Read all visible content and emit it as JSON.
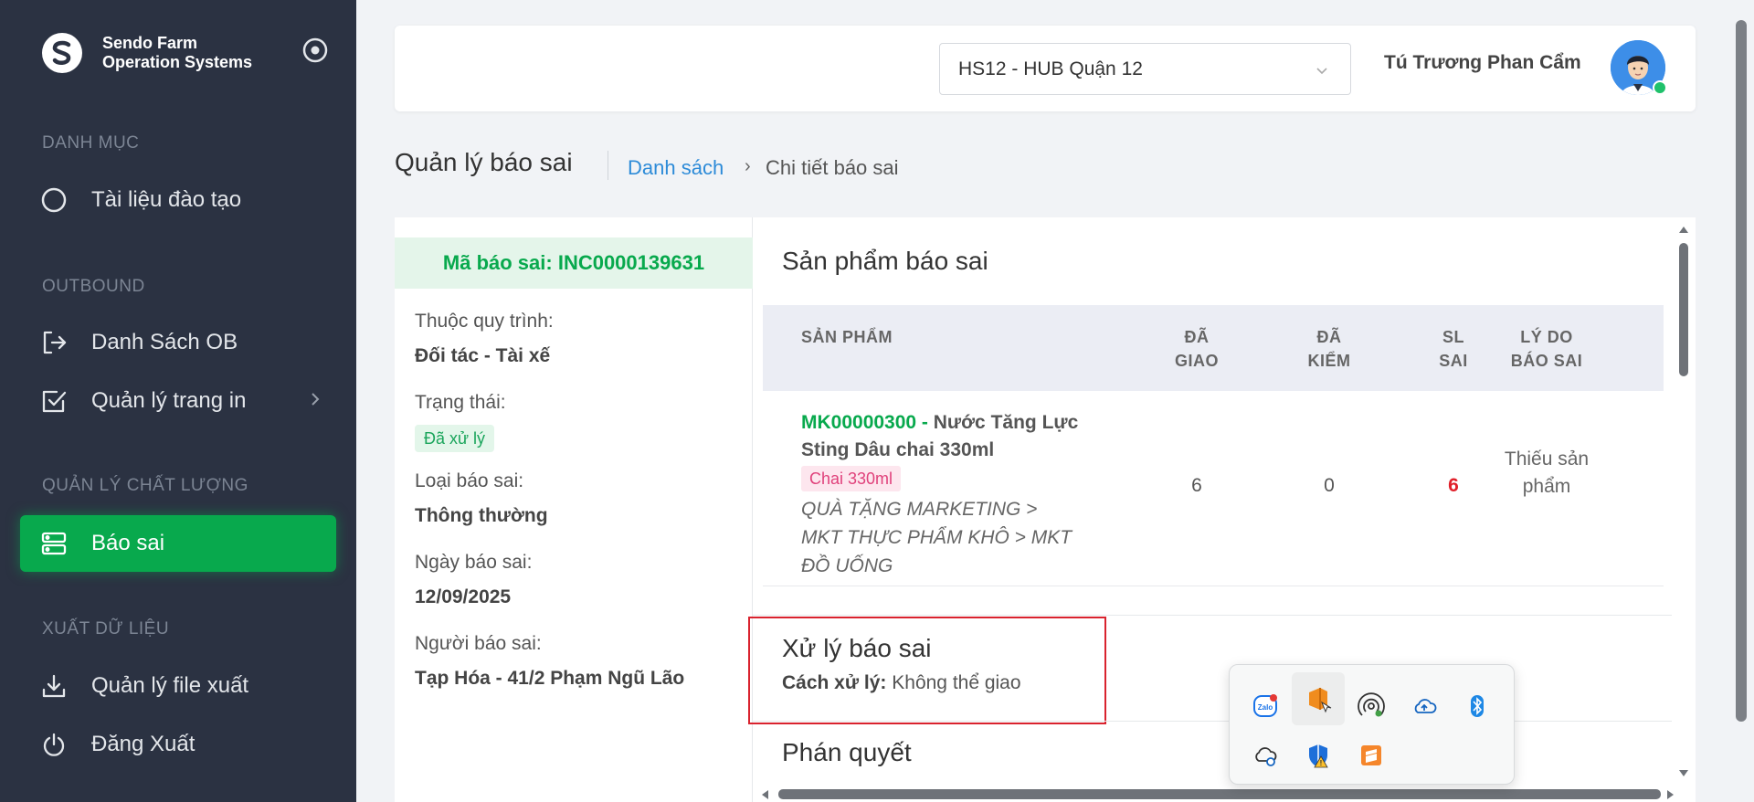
{
  "brand": {
    "line1": "Sendo Farm",
    "line2": "Operation Systems"
  },
  "sidebar": {
    "sections": [
      {
        "label": "DANH MỤC"
      },
      {
        "label": "OUTBOUND"
      },
      {
        "label": "QUẢN LÝ CHẤT LƯỢNG"
      },
      {
        "label": "XUẤT DỮ LIỆU"
      }
    ],
    "items": [
      {
        "label": "Tài liệu đào tạo"
      },
      {
        "label": "Danh Sách OB"
      },
      {
        "label": "Quản lý trang in"
      },
      {
        "label": "Báo sai"
      },
      {
        "label": "Quản lý file xuất"
      },
      {
        "label": "Đăng Xuất"
      }
    ]
  },
  "header": {
    "hub": "HS12 - HUB Quận 12",
    "user": "Tú Trương Phan Cẩm"
  },
  "page": {
    "title": "Quản lý báo sai",
    "crumb_link": "Danh sách",
    "crumb_sep": "›",
    "crumb_current": "Chi tiết báo sai"
  },
  "detail": {
    "code": "Mã báo sai: INC0000139631",
    "process_label": "Thuộc quy trình:",
    "process_value": "Đối tác - Tài xế",
    "status_label": "Trạng thái:",
    "status_value": "Đã xử lý",
    "type_label": "Loại báo sai:",
    "type_value": "Thông thường",
    "date_label": "Ngày báo sai:",
    "date_value": "12/09/2025",
    "reporter_label": "Người báo sai:",
    "reporter_value": "Tạp Hóa - 41/2 Phạm Ngũ Lão"
  },
  "products": {
    "title": "Sản phẩm báo sai",
    "headers": {
      "product": "SẢN PHẨM",
      "delivered_1": "ĐÃ",
      "delivered_2": "GIAO",
      "checked_1": "ĐÃ",
      "checked_2": "KIỂM",
      "wrong_1": "SL",
      "wrong_2": "SAI",
      "reason_1": "LÝ DO",
      "reason_2": "BÁO SAI"
    },
    "rows": [
      {
        "code": "MK00000300 -",
        "name": " Nước Tăng Lực Sting Dâu chai 330ml",
        "unit": "Chai 330ml",
        "category": "QUÀ TẶNG MARKETING > MKT THỰC PHẨM KHÔ > MKT ĐỒ UỐNG",
        "delivered": "6",
        "checked": "0",
        "wrong": "6",
        "reason": "Thiếu sản phẩm"
      }
    ]
  },
  "handling": {
    "title": "Xử lý báo sai",
    "method_label": "Cách xử lý:",
    "method_value": " Không thể giao"
  },
  "verdict": {
    "title": "Phán quyết"
  },
  "tray": {
    "items": [
      "zalo-icon",
      "office-icon",
      "hotspot-icon",
      "onedrive-icon",
      "bluetooth-icon",
      "cloud-sync-icon",
      "security-icon",
      "sublime-icon"
    ]
  },
  "colors": {
    "sidebar": "#2b3242",
    "accent": "#08a94d",
    "link": "#2d8bd8",
    "alert": "#e0202a"
  }
}
